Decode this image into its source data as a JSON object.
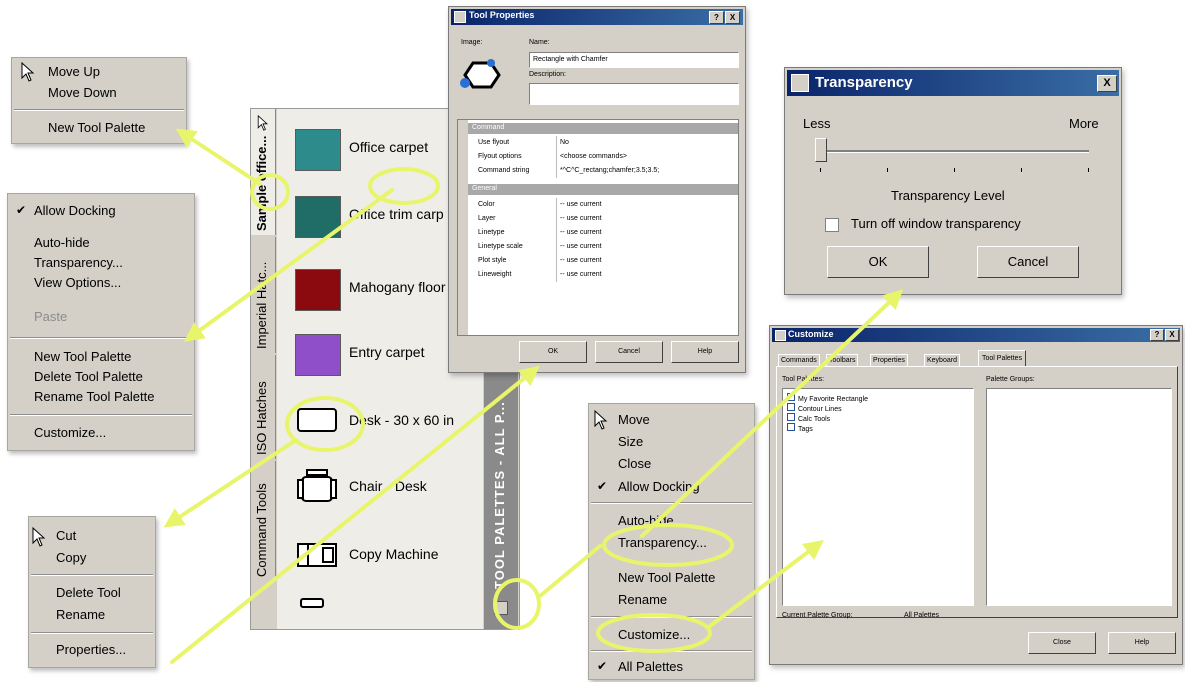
{
  "menu_palette_move": {
    "items": [
      "Move Up",
      "Move Down",
      "New Tool Palette"
    ]
  },
  "menu_palette_main": {
    "items": [
      "Allow Docking",
      "Auto-hide",
      "Transparency...",
      "View Options...",
      "Paste",
      "New Tool Palette",
      "Delete Tool Palette",
      "Rename Tool Palette",
      "Customize..."
    ]
  },
  "menu_tool": {
    "items": [
      "Cut",
      "Copy",
      "Delete Tool",
      "Rename",
      "Properties..."
    ]
  },
  "menu_titlebar": {
    "items": [
      "Move",
      "Size",
      "Close",
      "Allow Docking",
      "Auto-hide",
      "Transparency...",
      "New Tool Palette",
      "Rename",
      "Customize...",
      "All Palettes"
    ]
  },
  "palette": {
    "tabs": [
      "Sample office...",
      "Imperial Hatc...",
      "ISO Hatches",
      "Command Tools"
    ],
    "title_strip": "TOOL PALETTES - ALL P...",
    "items": [
      {
        "label": "Office carpet",
        "color": "#2e8b8b"
      },
      {
        "label": "Office trim carp",
        "color": "#1f6d66"
      },
      {
        "label": "Mahogany floor",
        "color": "#8b0a0f"
      },
      {
        "label": "Entry carpet",
        "color": "#8f4fc8"
      },
      {
        "label": "Desk - 30 x 60 in"
      },
      {
        "label": "Chair - Desk"
      },
      {
        "label": "Copy Machine"
      }
    ]
  },
  "tool_properties": {
    "title": "Tool Properties",
    "image_label": "Image:",
    "name_label": "Name:",
    "name_value": "Rectangle with Chamfer",
    "description_label": "Description:",
    "section_command": "Command",
    "rows_command": [
      {
        "k": "Use flyout",
        "v": "No"
      },
      {
        "k": "Flyout options",
        "v": "<choose commands>"
      },
      {
        "k": "Command string",
        "v": "*^C^C_rectang;chamfer;3.5;3.5;"
      }
    ],
    "section_general": "General",
    "rows_general": [
      {
        "k": "Color",
        "v": "-- use current"
      },
      {
        "k": "Layer",
        "v": "-- use current"
      },
      {
        "k": "Linetype",
        "v": "-- use current"
      },
      {
        "k": "Linetype scale",
        "v": "-- use current"
      },
      {
        "k": "Plot style",
        "v": "-- use current"
      },
      {
        "k": "Lineweight",
        "v": "-- use current"
      }
    ],
    "buttons": [
      "OK",
      "Cancel",
      "Help"
    ],
    "title_buttons": [
      "?",
      "X"
    ]
  },
  "transparency": {
    "title": "Transparency",
    "less": "Less",
    "more": "More",
    "level_label": "Transparency Level",
    "checkbox_label": "Turn off window transparency",
    "ok": "OK",
    "cancel": "Cancel",
    "close": "X"
  },
  "customize": {
    "title": "Customize",
    "tabs": [
      "Commands",
      "Toolbars",
      "Properties",
      "Keyboard",
      "Tool Palettes"
    ],
    "tool_palettes_label": "Tool Palettes:",
    "palette_groups_label": "Palette Groups:",
    "palettes": [
      "My Favorite Rectangle",
      "Contour Lines",
      "Calc Tools",
      "Tags"
    ],
    "current_group_label": "Current Palette Group:",
    "current_group_value": "All Palettes",
    "close": "Close",
    "help": "Help",
    "title_buttons": [
      "?",
      "X"
    ]
  },
  "colors": {
    "callout": "#e8f56a",
    "title_blue": "#0a246a",
    "menu_bg": "#d4d0c8"
  }
}
